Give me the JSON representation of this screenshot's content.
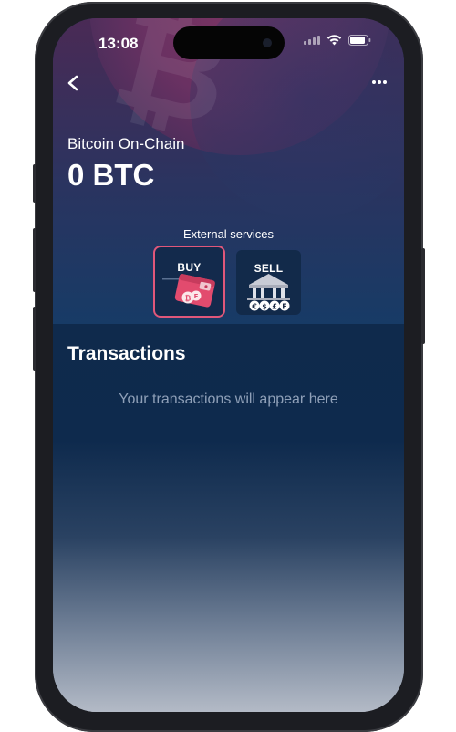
{
  "status_bar": {
    "time": "13:08"
  },
  "nav": {
    "back_icon": "chevron-left-icon",
    "more_icon": "ellipsis-icon"
  },
  "wallet": {
    "name": "Bitcoin On-Chain",
    "balance": "0 BTC"
  },
  "external_services": {
    "label": "External services",
    "buy": {
      "label": "BUY",
      "coin_letters": "B/"
    },
    "sell": {
      "label": "SELL",
      "coin_symbols": [
        "€",
        "$",
        "£",
        "F"
      ]
    }
  },
  "transactions": {
    "title": "Transactions",
    "empty_text": "Your transactions will appear here"
  },
  "colors": {
    "background_top": "#4a2a55",
    "background_main": "#13365f",
    "buy_highlight": "#e0577a",
    "empty_text": "#8fa0b8"
  }
}
